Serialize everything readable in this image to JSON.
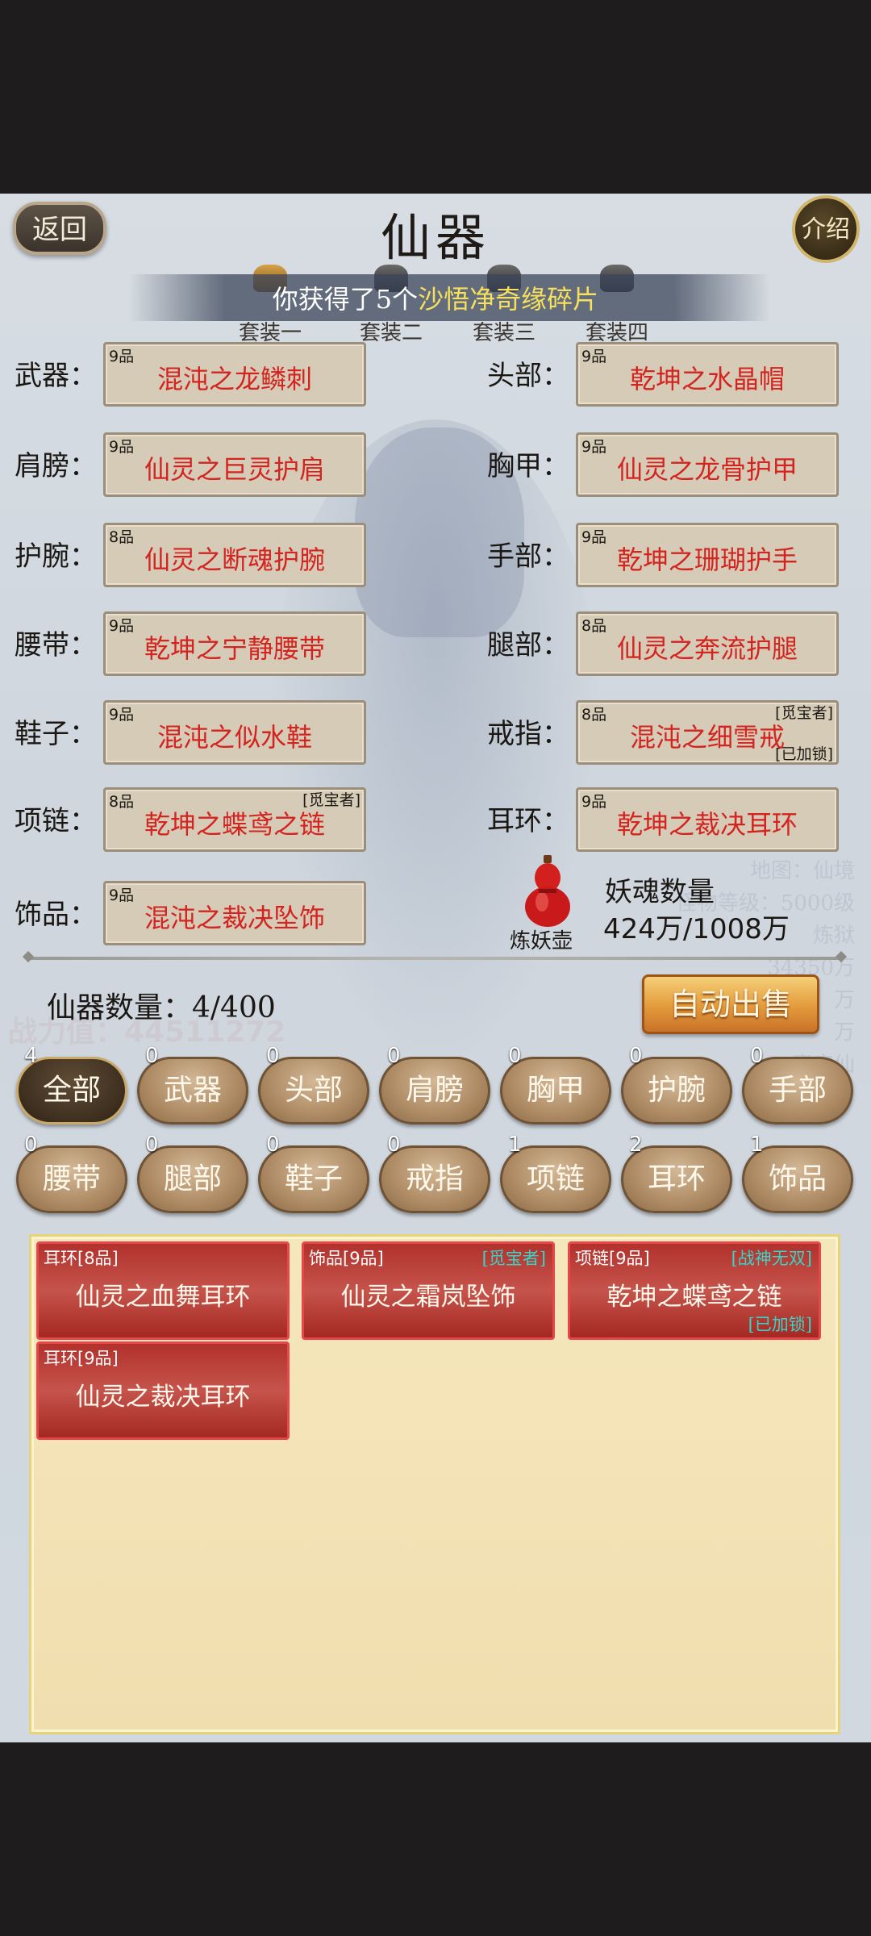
{
  "header": {
    "back_label": "返回",
    "title": "仙器",
    "intro_label": "介绍"
  },
  "banner": {
    "prefix": "你获得了5个",
    "highlight": "沙悟净奇缘碎片"
  },
  "suits": [
    "套装一",
    "套装二",
    "套装三",
    "套装四"
  ],
  "slots": {
    "weapon": {
      "label": "武器：",
      "grade": "9品",
      "name": "混沌之龙鳞刺"
    },
    "head": {
      "label": "头部：",
      "grade": "9品",
      "name": "乾坤之水晶帽"
    },
    "shoulder": {
      "label": "肩膀：",
      "grade": "9品",
      "name": "仙灵之巨灵护肩"
    },
    "chest": {
      "label": "胸甲：",
      "grade": "9品",
      "name": "仙灵之龙骨护甲"
    },
    "wrist": {
      "label": "护腕：",
      "grade": "8品",
      "name": "仙灵之断魂护腕"
    },
    "hand": {
      "label": "手部：",
      "grade": "9品",
      "name": "乾坤之珊瑚护手"
    },
    "belt": {
      "label": "腰带：",
      "grade": "9品",
      "name": "乾坤之宁静腰带"
    },
    "leg": {
      "label": "腿部：",
      "grade": "8品",
      "name": "仙灵之奔流护腿"
    },
    "shoe": {
      "label": "鞋子：",
      "grade": "9品",
      "name": "混沌之似水鞋"
    },
    "ring": {
      "label": "戒指：",
      "grade": "8品",
      "name": "混沌之细雪戒",
      "tag": "[觅宝者]",
      "lock": "[已加锁]"
    },
    "necklace": {
      "label": "项链：",
      "grade": "8品",
      "name": "乾坤之蝶鸢之链",
      "tag": "[觅宝者]"
    },
    "earring": {
      "label": "耳环：",
      "grade": "9品",
      "name": "乾坤之裁决耳环"
    },
    "ornament": {
      "label": "饰品：",
      "grade": "9品",
      "name": "混沌之裁决坠饰"
    }
  },
  "soul": {
    "gourd_label": "炼妖壶",
    "label": "妖魂数量",
    "value": "424万/1008万"
  },
  "background_text": {
    "lines": [
      "地图：仙境",
      "怪物等级：5000级",
      "炼狱",
      "34350万",
      "万",
      "万",
      "宇宙仙"
    ],
    "power": "战力值：44511272"
  },
  "inventory": {
    "count_label": "仙器数量：4/400",
    "auto_sell_label": "自动出售"
  },
  "filters": [
    {
      "label": "全部",
      "count": "4"
    },
    {
      "label": "武器",
      "count": "0"
    },
    {
      "label": "头部",
      "count": "0"
    },
    {
      "label": "肩膀",
      "count": "0"
    },
    {
      "label": "胸甲",
      "count": "0"
    },
    {
      "label": "护腕",
      "count": "0"
    },
    {
      "label": "手部",
      "count": "0"
    },
    {
      "label": "腰带",
      "count": "0"
    },
    {
      "label": "腿部",
      "count": "0"
    },
    {
      "label": "鞋子",
      "count": "0"
    },
    {
      "label": "戒指",
      "count": "0"
    },
    {
      "label": "项链",
      "count": "1"
    },
    {
      "label": "耳环",
      "count": "2"
    },
    {
      "label": "饰品",
      "count": "1"
    }
  ],
  "items": [
    {
      "type": "耳环[8品]",
      "name": "仙灵之血舞耳环"
    },
    {
      "type": "饰品[9品]",
      "name": "仙灵之霜岚坠饰",
      "tag": "[觅宝者]"
    },
    {
      "type": "项链[9品]",
      "name": "乾坤之蝶鸢之链",
      "tag": "[战神无双]",
      "lock": "[已加锁]"
    },
    {
      "type": "耳环[9品]",
      "name": "仙灵之裁决耳环"
    }
  ],
  "colors": {
    "item_name_red": "#d42420",
    "tag_cyan": "#35d6c9",
    "banner_highlight": "#f6e05c",
    "card_red": "#b2312c"
  }
}
